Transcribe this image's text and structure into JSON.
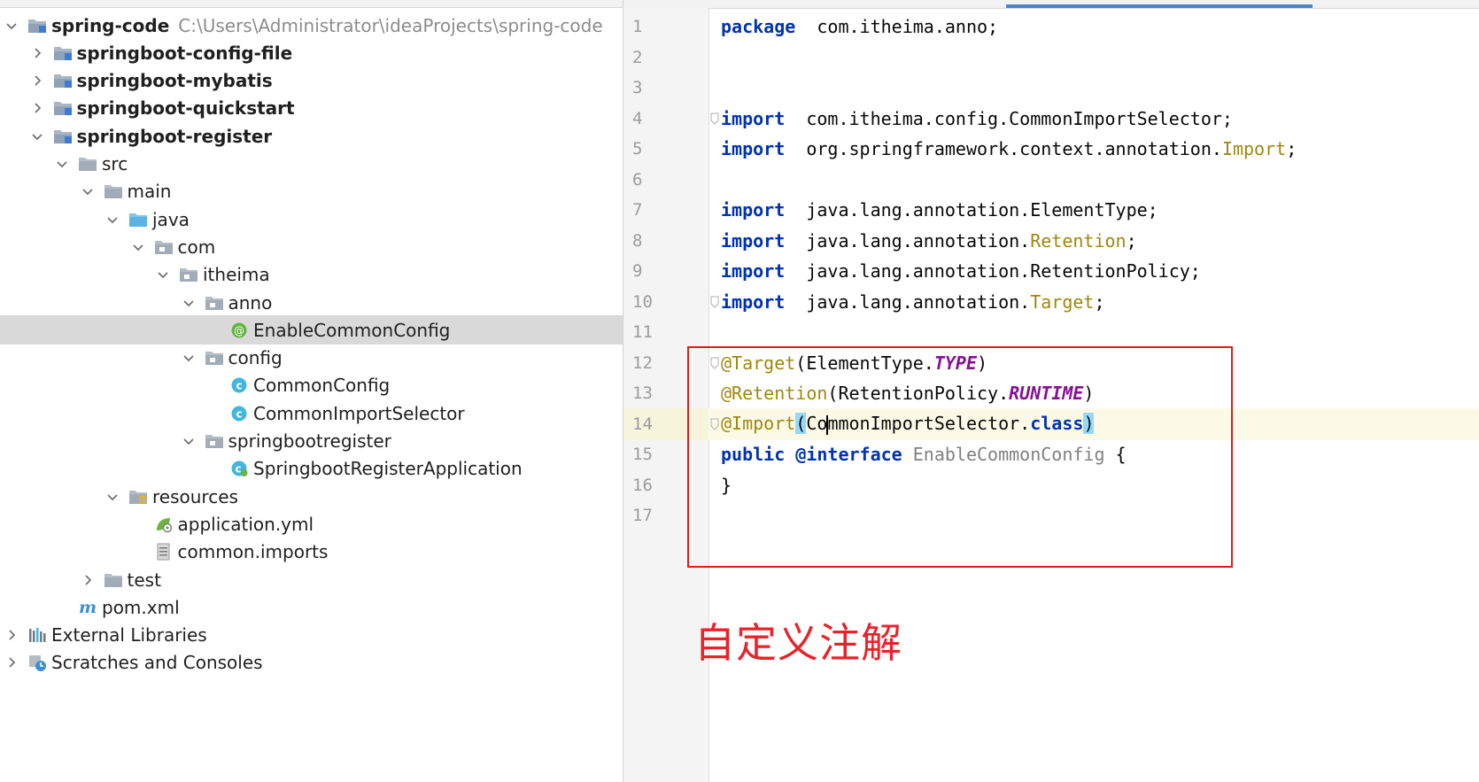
{
  "tree": [
    {
      "depth": 0,
      "expanded": true,
      "icon": "module-folder-icon",
      "label": "spring-code",
      "bold": true,
      "path": "C:\\Users\\Administrator\\ideaProjects\\spring-code"
    },
    {
      "depth": 1,
      "expanded": false,
      "icon": "module-folder-icon",
      "label": "springboot-config-file",
      "bold": true
    },
    {
      "depth": 1,
      "expanded": false,
      "icon": "module-folder-icon",
      "label": "springboot-mybatis",
      "bold": true
    },
    {
      "depth": 1,
      "expanded": false,
      "icon": "module-folder-icon",
      "label": "springboot-quickstart",
      "bold": true
    },
    {
      "depth": 1,
      "expanded": true,
      "icon": "module-folder-icon",
      "label": "springboot-register",
      "bold": true
    },
    {
      "depth": 2,
      "expanded": true,
      "icon": "folder-icon",
      "label": "src"
    },
    {
      "depth": 3,
      "expanded": true,
      "icon": "folder-icon",
      "label": "main"
    },
    {
      "depth": 4,
      "expanded": true,
      "icon": "source-folder-icon",
      "label": "java"
    },
    {
      "depth": 5,
      "expanded": true,
      "icon": "package-icon",
      "label": "com"
    },
    {
      "depth": 6,
      "expanded": true,
      "icon": "package-icon",
      "label": "itheima"
    },
    {
      "depth": 7,
      "expanded": true,
      "icon": "package-icon",
      "label": "anno"
    },
    {
      "depth": 8,
      "leaf": true,
      "icon": "annotation-class-icon",
      "label": "EnableCommonConfig",
      "selected": true
    },
    {
      "depth": 7,
      "expanded": true,
      "icon": "package-icon",
      "label": "config"
    },
    {
      "depth": 8,
      "leaf": true,
      "icon": "class-icon",
      "label": "CommonConfig"
    },
    {
      "depth": 8,
      "leaf": true,
      "icon": "class-icon",
      "label": "CommonImportSelector"
    },
    {
      "depth": 7,
      "expanded": true,
      "icon": "package-icon",
      "label": "springbootregister"
    },
    {
      "depth": 8,
      "leaf": true,
      "icon": "spring-boot-class-icon",
      "label": "SpringbootRegisterApplication"
    },
    {
      "depth": 4,
      "expanded": true,
      "icon": "resources-folder-icon",
      "label": "resources"
    },
    {
      "depth": 5,
      "leaf": true,
      "icon": "yaml-file-icon",
      "label": "application.yml"
    },
    {
      "depth": 5,
      "leaf": true,
      "icon": "text-file-icon",
      "label": "common.imports"
    },
    {
      "depth": 3,
      "expanded": false,
      "icon": "folder-icon",
      "label": "test"
    },
    {
      "depth": 2,
      "leaf": true,
      "icon": "maven-icon",
      "label": "pom.xml"
    },
    {
      "depth": 0,
      "expanded": false,
      "icon": "libraries-icon",
      "label": "External Libraries"
    },
    {
      "depth": 0,
      "expanded": false,
      "icon": "scratches-icon",
      "label": "Scratches and Consoles"
    }
  ],
  "editor": {
    "current_line": 14,
    "lines": [
      {
        "n": "1",
        "tokens": [
          [
            "kw",
            "package"
          ],
          [
            "",
            "  com.itheima.anno;"
          ]
        ]
      },
      {
        "n": "2",
        "tokens": []
      },
      {
        "n": "3",
        "tokens": []
      },
      {
        "n": "4",
        "fold": true,
        "tokens": [
          [
            "kw",
            "import"
          ],
          [
            "",
            "  com.itheima.config.CommonImportSelector;"
          ]
        ]
      },
      {
        "n": "5",
        "tokens": [
          [
            "kw",
            "import"
          ],
          [
            "",
            "  org.springframework.context.annotation."
          ],
          [
            "ann",
            "Import"
          ],
          [
            "",
            ";"
          ]
        ]
      },
      {
        "n": "6",
        "tokens": []
      },
      {
        "n": "7",
        "tokens": [
          [
            "kw",
            "import"
          ],
          [
            "",
            "  java.lang.annotation.ElementType;"
          ]
        ]
      },
      {
        "n": "8",
        "tokens": [
          [
            "kw",
            "import"
          ],
          [
            "",
            "  java.lang.annotation."
          ],
          [
            "ann",
            "Retention"
          ],
          [
            "",
            ";"
          ]
        ]
      },
      {
        "n": "9",
        "tokens": [
          [
            "kw",
            "import"
          ],
          [
            "",
            "  java.lang.annotation.RetentionPolicy;"
          ]
        ]
      },
      {
        "n": "10",
        "fold": true,
        "tokens": [
          [
            "kw",
            "import"
          ],
          [
            "",
            "  java.lang.annotation."
          ],
          [
            "ann",
            "Target"
          ],
          [
            "",
            ";"
          ]
        ]
      },
      {
        "n": "11",
        "tokens": []
      },
      {
        "n": "12",
        "fold": true,
        "tokens": [
          [
            "ann",
            "@Target"
          ],
          [
            "",
            "(ElementType."
          ],
          [
            "const",
            "TYPE"
          ],
          [
            "",
            ")"
          ]
        ]
      },
      {
        "n": "13",
        "tokens": [
          [
            "ann",
            "@Retention"
          ],
          [
            "",
            "(RetentionPolicy."
          ],
          [
            "const",
            "RUNTIME"
          ],
          [
            "",
            ")"
          ]
        ]
      },
      {
        "n": "14",
        "fold": true,
        "tokens": [
          [
            "ann",
            "@Import"
          ],
          [
            "hl",
            "("
          ],
          [
            "",
            "Co"
          ],
          [
            "caret",
            ""
          ],
          [
            "",
            "mmonImportSelector."
          ],
          [
            "kw",
            "class"
          ],
          [
            "hl",
            ")"
          ]
        ]
      },
      {
        "n": "15",
        "tokens": [
          [
            "kw",
            "public"
          ],
          [
            "",
            " "
          ],
          [
            "kw",
            "@interface"
          ],
          [
            "",
            " "
          ],
          [
            "gray",
            "EnableCommonConfig"
          ],
          [
            "",
            " {"
          ]
        ]
      },
      {
        "n": "16",
        "tokens": [
          [
            "",
            "}"
          ]
        ]
      },
      {
        "n": "17",
        "tokens": []
      }
    ]
  },
  "annotation": {
    "text": "自定义注解",
    "color": "#e8232a"
  }
}
